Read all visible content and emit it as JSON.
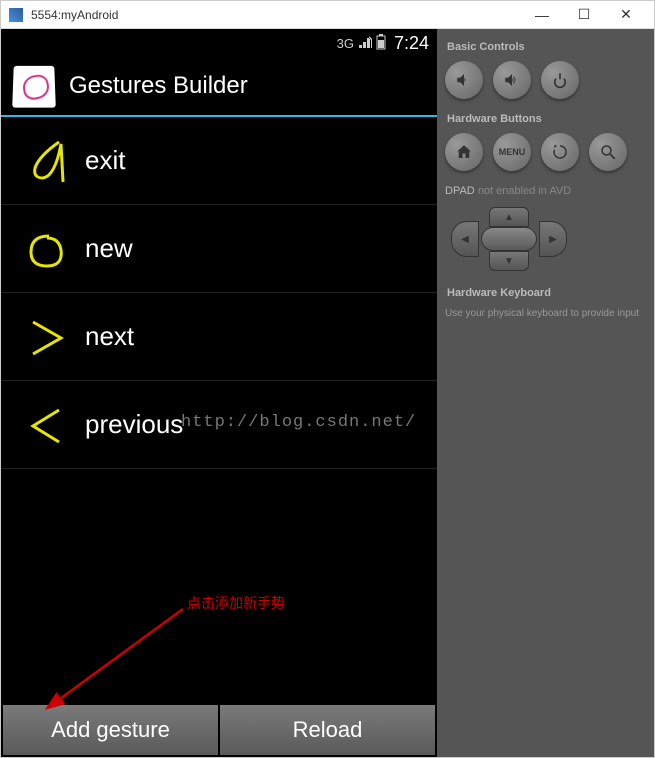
{
  "window": {
    "title": "5554:myAndroid"
  },
  "status": {
    "network": "3G",
    "time": "7:24"
  },
  "app": {
    "title": "Gestures Builder"
  },
  "gestures": [
    {
      "label": "exit"
    },
    {
      "label": "new"
    },
    {
      "label": "next"
    },
    {
      "label": "previous"
    }
  ],
  "buttons": {
    "add": "Add gesture",
    "reload": "Reload"
  },
  "panel": {
    "basic_controls": "Basic Controls",
    "hardware_buttons": "Hardware Buttons",
    "menu_label": "MENU",
    "dpad_title": "DPAD",
    "dpad_note": "not enabled in AVD",
    "hw_keyboard_title": "Hardware Keyboard",
    "hw_keyboard_note": "Use your physical keyboard to provide input"
  },
  "annotation": {
    "text": "点击添加新手势"
  },
  "watermark": "http://blog.csdn.net/"
}
